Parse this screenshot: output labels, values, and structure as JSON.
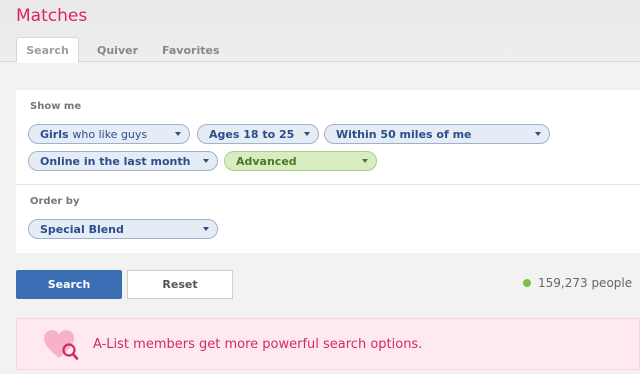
{
  "header": {
    "title": "Matches",
    "tabs": [
      {
        "label": "Search",
        "active": true
      },
      {
        "label": "Quiver",
        "active": false
      },
      {
        "label": "Favorites",
        "active": false
      }
    ]
  },
  "filters": {
    "show_me_label": "Show me",
    "gender": {
      "bold": "Girls",
      "light": "who like guys"
    },
    "ages": "Ages 18 to 25",
    "distance": "Within 50 miles of me",
    "online": "Online in the last month",
    "advanced": "Advanced",
    "order_by_label": "Order by",
    "order": "Special Blend"
  },
  "actions": {
    "search_label": "Search",
    "reset_label": "Reset"
  },
  "results": {
    "count_text": "159,273 people"
  },
  "banner": {
    "text": "A-List members get more powerful search options.",
    "icon": "heart-search-icon"
  },
  "colors": {
    "accent_pink": "#e0245e",
    "search_blue": "#3a6db3",
    "online_green": "#7cc142"
  }
}
